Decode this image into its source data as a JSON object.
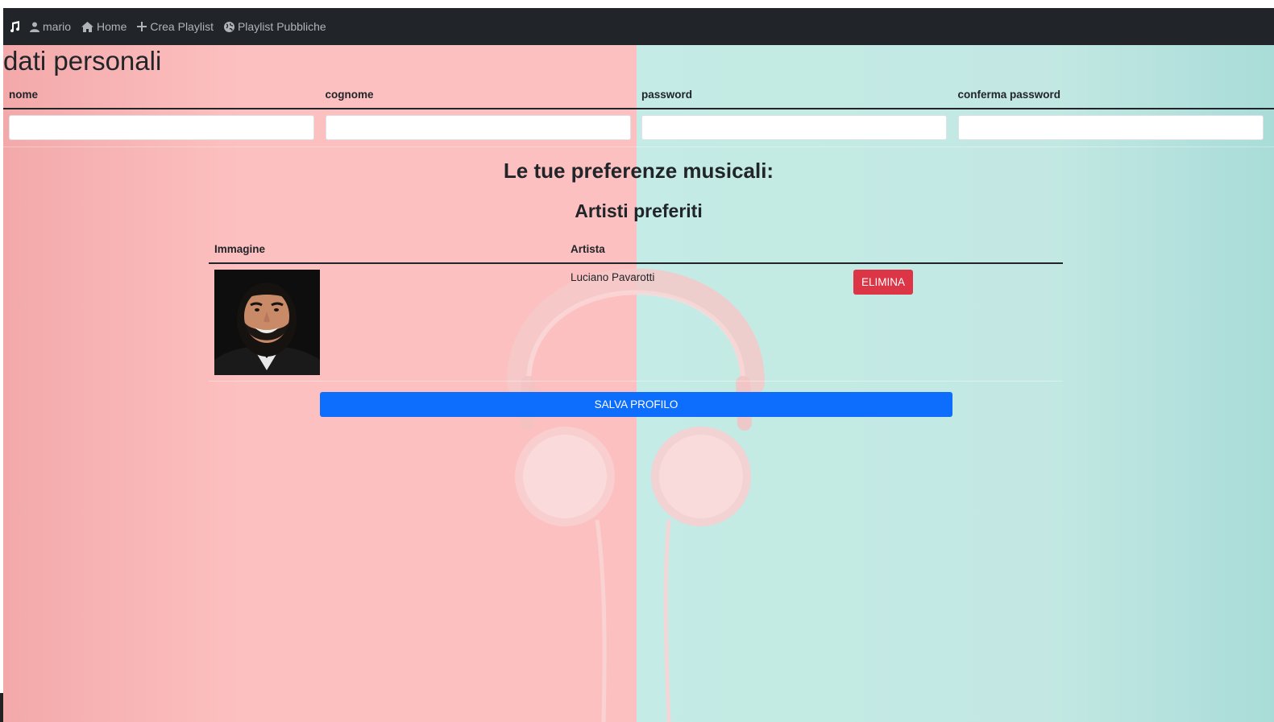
{
  "navbar": {
    "brand_icon": "music-note-icon",
    "items": [
      {
        "label": "mario",
        "icon": "user-icon"
      },
      {
        "label": "Home",
        "icon": "home-icon"
      },
      {
        "label": "Crea Playlist",
        "icon": "plus-icon"
      },
      {
        "label": "Playlist Pubbliche",
        "icon": "globe-icon"
      }
    ]
  },
  "profile": {
    "title": "dati personali",
    "columns": [
      "nome",
      "cognome",
      "password",
      "conferma password"
    ],
    "values": [
      "",
      "",
      "",
      ""
    ]
  },
  "preferences": {
    "heading": "Le tue preferenze musicali:",
    "artists_heading": "Artisti preferiti",
    "columns": [
      "Immagine",
      "Artista"
    ],
    "artists": [
      {
        "name": "Luciano Pavarotti",
        "delete_label": "ELIMINA"
      }
    ]
  },
  "save_label": "SALVA PROFILO",
  "colors": {
    "navbar": "#212529",
    "danger": "#dc3545",
    "primary": "#0d6efd",
    "bg_pink": "#fdc0c0",
    "bg_teal": "#c4ebe5"
  }
}
